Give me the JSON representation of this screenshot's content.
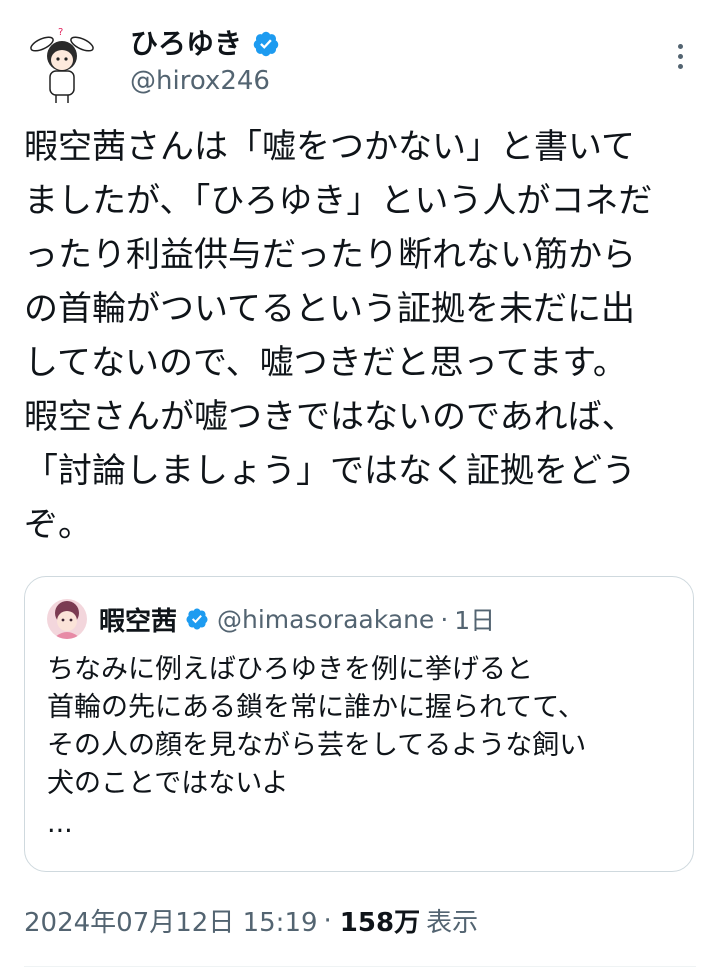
{
  "author": {
    "name": "ひろゆき",
    "handle": "@hirox246",
    "verified": true
  },
  "tweet": {
    "text": "暇空茜さんは「嘘をつかない」と書いて\nましたが、「ひろゆき」という人がコネだ\nったり利益供与だったり断れない筋から\nの首輪がついてるという証拠を未だに出\nしてないので、嘘つきだと思ってます。\n暇空さんが嘘つきではないのであれば、\n「討論しましょう」ではなく証拠をどう\nぞ。"
  },
  "quoted": {
    "name": "暇空茜",
    "handle": "@himasoraakane",
    "separator": "·",
    "time": "1日",
    "verified": true,
    "text": "ちなみに例えばひろゆきを例に挙げると\n首輪の先にある鎖を常に誰かに握られてて、\nその人の顔を見ながら芸をしてるような飼い\n犬のことではないよ",
    "ellipsis": "..."
  },
  "meta": {
    "timestamp": "2024年07月12日 15:19",
    "separator": "·",
    "views": "158万",
    "views_label": "表示"
  },
  "colors": {
    "verified": "#1d9bf0",
    "secondary_text": "#536471",
    "border": "#cfd9de"
  },
  "icons": {
    "verified": "verified-badge-icon",
    "more": "more-options-icon"
  }
}
